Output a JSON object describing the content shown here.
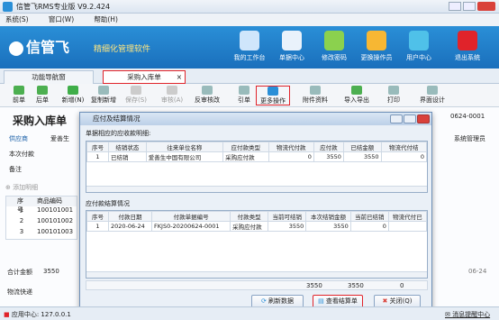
{
  "app": {
    "title": "信管飞RMS专业版 V9.2.424",
    "logo": "信管飞",
    "slogan": "精细化管理软件"
  },
  "menu": [
    "系统(S)",
    "窗口(W)",
    "帮助(H)"
  ],
  "banner_buttons": [
    "我的工作台",
    "单据中心",
    "修改密码",
    "更换操作员",
    "用户中心",
    "退出系统"
  ],
  "tabs": {
    "nav": "功能导航窗",
    "active": "采购入库单"
  },
  "toolbar": [
    "前单",
    "后单",
    "新增(N)",
    "复制新增",
    "保存(S)",
    "审核(A)",
    "反审核改",
    "引单",
    "更多操作",
    "附件资料",
    "导入导出",
    "打印",
    "界面设计"
  ],
  "form": {
    "title": "采购入库单",
    "supplier_label": "供应商",
    "supplier_value": "爱善生",
    "payment_label": "本次付款",
    "remark_label": "备注",
    "doc_no": "0624-0001",
    "operator": "系统管理员",
    "add_detail": "添加明细",
    "items_header": [
      "序号",
      "商品编码"
    ],
    "items": [
      [
        "1",
        "100101001"
      ],
      [
        "2",
        "100101002"
      ],
      [
        "3",
        "100101003"
      ]
    ],
    "total_label": "合计金额",
    "total_value": "3550",
    "logistics_label": "物流快递",
    "date_tail": "06-24"
  },
  "dialog": {
    "title": "应付及结算情况",
    "section1": "单据相应的应收款明细:",
    "grid1_headers": [
      "序号",
      "结销状态",
      "往来单位名称",
      "应付款类型",
      "物流代付款",
      "应付款",
      "已结金额",
      "物流代付结"
    ],
    "grid1_rows": [
      [
        "1",
        "已结销",
        "爱善生中国有限公司",
        "采购应付款",
        "0",
        "3550",
        "3550",
        "0"
      ]
    ],
    "section2": "应付款结算情况",
    "grid2_headers": [
      "序号",
      "付款日期",
      "付款单据编号",
      "付款类型",
      "当前可结销",
      "本次结销金额",
      "当前已结销",
      "物流代付已"
    ],
    "grid2_rows": [
      [
        "1",
        "2020-06-24",
        "FKJS0-20200624-0001",
        "采购应付款",
        "3550",
        "3550",
        "0",
        ""
      ]
    ],
    "grid2_footer": [
      "3550",
      "3550",
      "0"
    ],
    "btn_refresh": "刷新数据",
    "btn_view": "查看结算单",
    "btn_close": "关闭(Q)"
  },
  "status": {
    "left": "应用中心: 127.0.0.1",
    "right": "消息提醒中心"
  }
}
